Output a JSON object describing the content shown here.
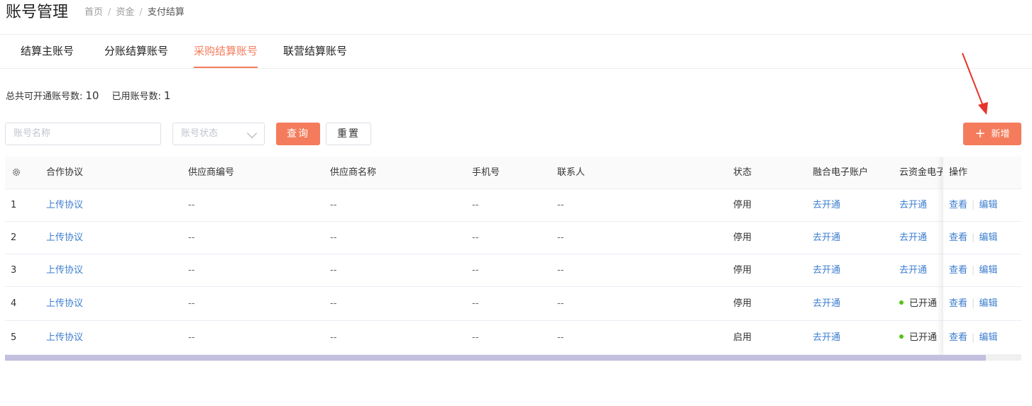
{
  "header": {
    "title": "账号管理",
    "breadcrumb": [
      "首页",
      "资金",
      "支付结算"
    ]
  },
  "tabs": [
    {
      "label": "结算主账号",
      "active": false
    },
    {
      "label": "分账结算账号",
      "active": false
    },
    {
      "label": "采购结算账号",
      "active": true
    },
    {
      "label": "联营结算账号",
      "active": false
    }
  ],
  "summary": {
    "total_label": "总共可开通账号数:",
    "total_value": "10",
    "used_label": "已用账号数:",
    "used_value": "1"
  },
  "filters": {
    "name_placeholder": "账号名称",
    "status_placeholder": "账号状态",
    "query_label": "查询",
    "reset_label": "重置",
    "add_label": "新增"
  },
  "table": {
    "columns": [
      "合作协议",
      "供应商编号",
      "供应商名称",
      "手机号",
      "联系人",
      "状态",
      "融合电子账户",
      "云资金电子",
      "操作"
    ],
    "rows": [
      {
        "index": "1",
        "agreement": "上传协议",
        "supplier_no": "--",
        "supplier_name": "--",
        "phone": "--",
        "contact": "--",
        "status": "停用",
        "fusion": "去开通",
        "cloud": "去开通",
        "cloud_opened": false,
        "view": "查看",
        "edit": "编辑"
      },
      {
        "index": "2",
        "agreement": "上传协议",
        "supplier_no": "--",
        "supplier_name": "--",
        "phone": "--",
        "contact": "--",
        "status": "停用",
        "fusion": "去开通",
        "cloud": "去开通",
        "cloud_opened": false,
        "view": "查看",
        "edit": "编辑"
      },
      {
        "index": "3",
        "agreement": "上传协议",
        "supplier_no": "--",
        "supplier_name": "--",
        "phone": "--",
        "contact": "--",
        "status": "停用",
        "fusion": "去开通",
        "cloud": "去开通",
        "cloud_opened": false,
        "view": "查看",
        "edit": "编辑"
      },
      {
        "index": "4",
        "agreement": "上传协议",
        "supplier_no": "--",
        "supplier_name": "--",
        "phone": "--",
        "contact": "--",
        "status": "停用",
        "fusion": "去开通",
        "cloud": "已开通",
        "cloud_opened": true,
        "view": "查看",
        "edit": "编辑"
      },
      {
        "index": "5",
        "agreement": "上传协议",
        "supplier_no": "--",
        "supplier_name": "--",
        "phone": "--",
        "contact": "--",
        "status": "启用",
        "fusion": "去开通",
        "cloud": "已开通",
        "cloud_opened": true,
        "view": "查看",
        "edit": "编辑"
      }
    ]
  },
  "colors": {
    "accent": "#f47c5c",
    "link": "#3d7ecf",
    "opened_dot": "#52c41a",
    "scrollbar": "#c2c0de"
  }
}
